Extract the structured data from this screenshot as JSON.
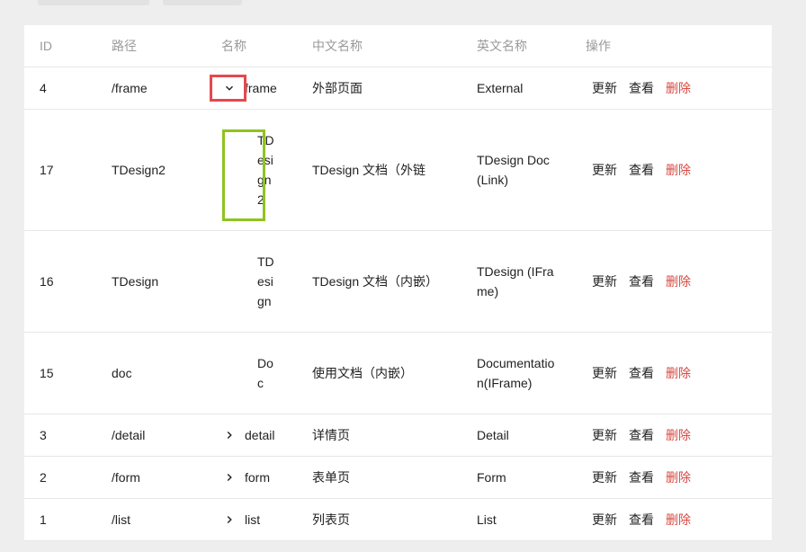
{
  "headers": {
    "id": "ID",
    "path": "路径",
    "name": "名称",
    "cn_name": "中文名称",
    "en_name": "英文名称",
    "actions": "操作"
  },
  "actions": {
    "update": "更新",
    "view": "查看",
    "delete": "删除"
  },
  "rows": [
    {
      "id": "4",
      "path": "/frame",
      "name": "frame",
      "cn": "外部页面",
      "en": "External"
    },
    {
      "id": "17",
      "path": "TDesign2",
      "name": "TDesign2",
      "cn": "TDesign 文档（外链",
      "en": "TDesign Doc(Link)"
    },
    {
      "id": "16",
      "path": "TDesign",
      "name": "TDesign",
      "cn": "TDesign 文档（内嵌）",
      "en": "TDesign (IFrame)"
    },
    {
      "id": "15",
      "path": "doc",
      "name": "Doc",
      "cn": "使用文档（内嵌）",
      "en": "Documentation(IFrame)"
    },
    {
      "id": "3",
      "path": "/detail",
      "name": "detail",
      "cn": "详情页",
      "en": "Detail"
    },
    {
      "id": "2",
      "path": "/form",
      "name": "form",
      "cn": "表单页",
      "en": "Form"
    },
    {
      "id": "1",
      "path": "/list",
      "name": "list",
      "cn": "列表页",
      "en": "List"
    }
  ],
  "colors": {
    "delete": "#d54941",
    "highlight_red": "#e5484d",
    "highlight_green": "#8fc31f"
  }
}
